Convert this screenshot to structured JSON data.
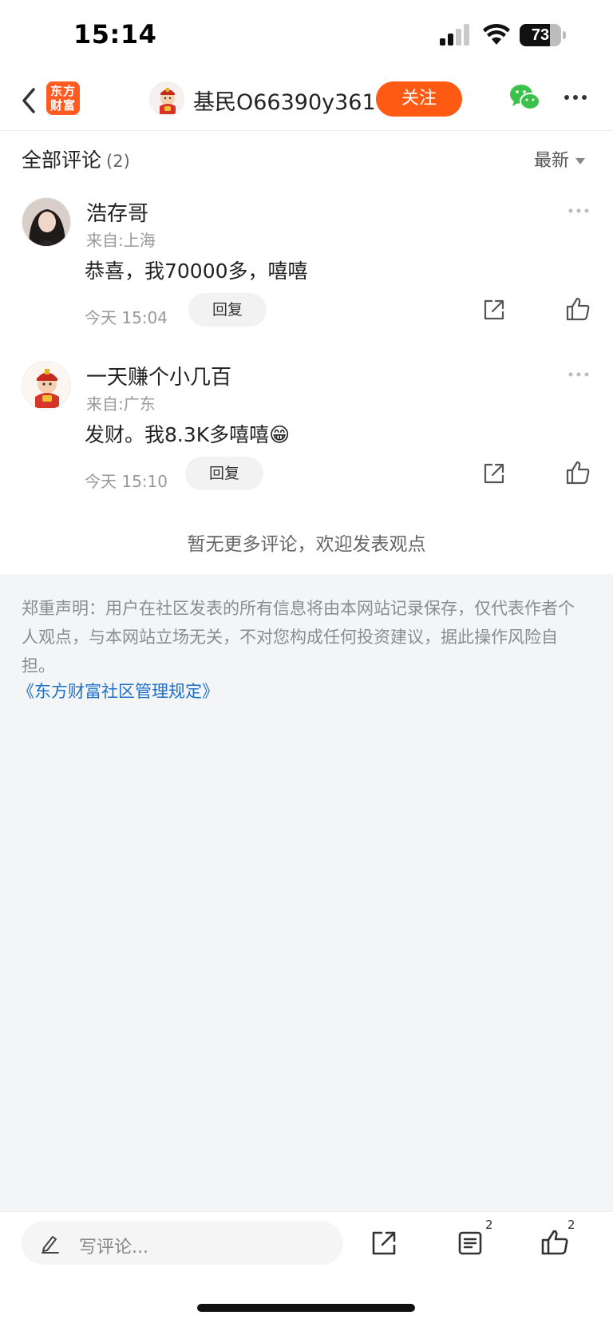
{
  "status_bar": {
    "time": "15:14",
    "battery": "73",
    "battery_level": 0.73
  },
  "header": {
    "logo_text_line1": "东方",
    "logo_text_line2": "财富",
    "author_name": "基民O66390y361",
    "follow_label": "关注"
  },
  "comments_section": {
    "title": "全部评论",
    "count": "(2)",
    "sort_label": "最新",
    "no_more_text": "暂无更多评论，欢迎发表观点",
    "reply_label": "回复",
    "items": [
      {
        "name": "浩存哥",
        "location": "来自:上海",
        "text": "恭喜，我70000多，嘻嘻",
        "time": "今天 15:04"
      },
      {
        "name": "一天赚个小几百",
        "location": "来自:广东",
        "text": "发财。我8.3K多嘻嘻😁",
        "time": "今天 15:10"
      }
    ]
  },
  "disclaimer": {
    "text": "郑重声明：用户在社区发表的所有信息将由本网站记录保存，仅代表作者个人观点，与本网站立场无关，不对您构成任何投资建议，据此操作风险自担。",
    "link_text": "《东方财富社区管理规定》"
  },
  "bottom_bar": {
    "comment_placeholder": "写评论...",
    "comment_count": "2",
    "like_count": "2"
  },
  "colors": {
    "accent": "#ff5a14",
    "link": "#1d6fc9",
    "page_bg": "#f4f5f7"
  }
}
